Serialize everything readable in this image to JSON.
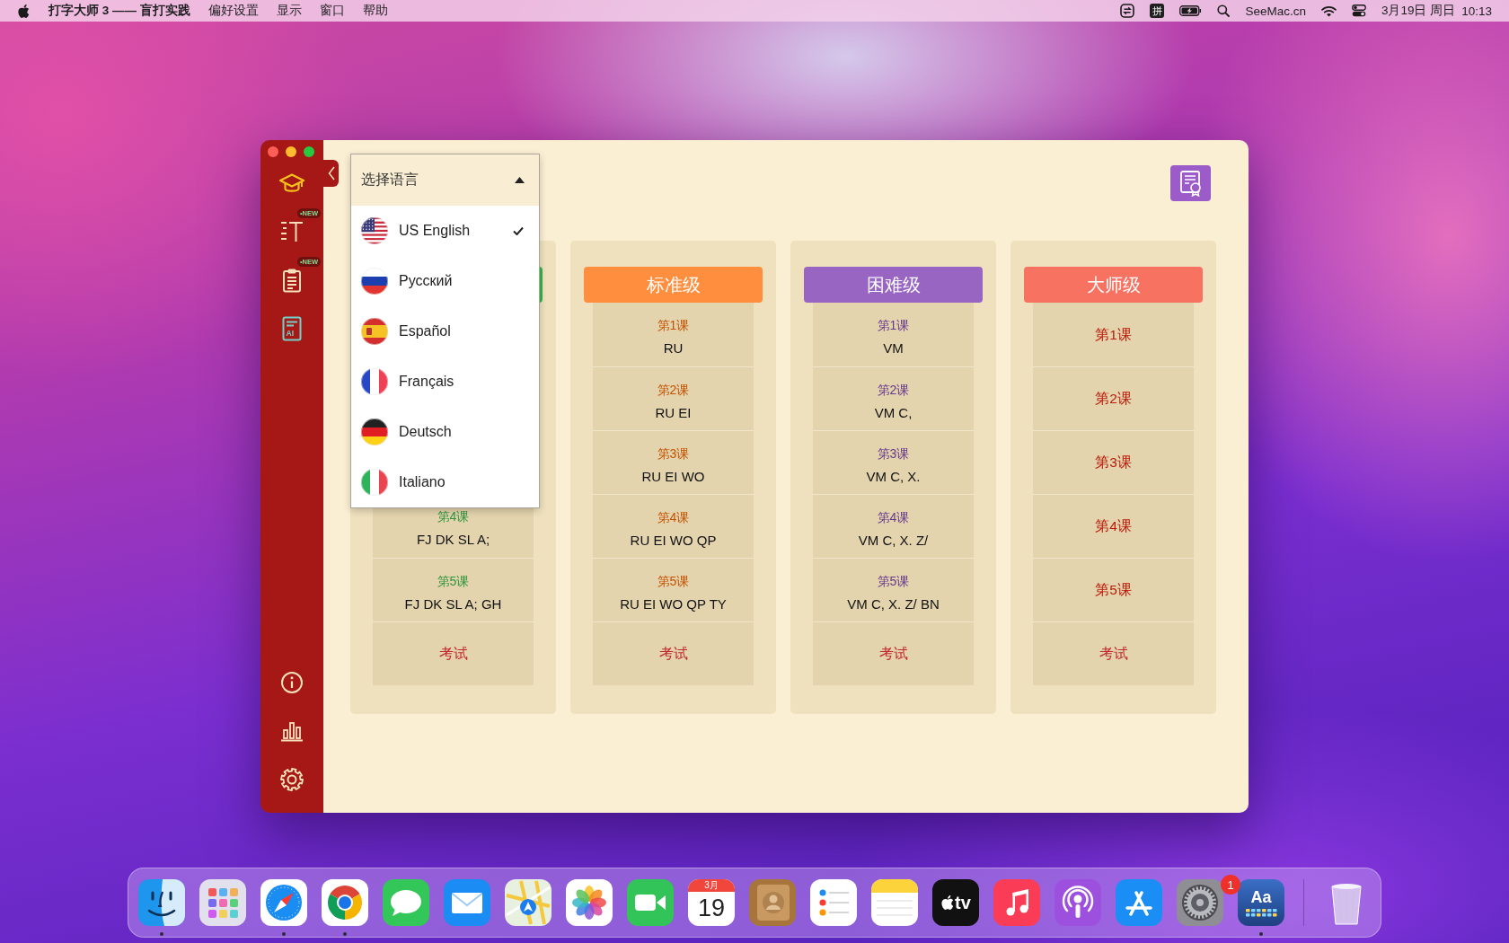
{
  "menu_bar": {
    "app_name": "打字大师 3 —— 盲打实践",
    "menus": [
      "偏好设置",
      "显示",
      "窗口",
      "帮助"
    ],
    "input_method": "拼",
    "site": "SeeMac.cn",
    "date": "3月19日 周日",
    "time": "10:13"
  },
  "sidebar": {
    "items": [
      {
        "selected": true
      },
      {
        "selected": false,
        "badge": "•NEW"
      },
      {
        "selected": false,
        "badge": "•NEW"
      },
      {
        "selected": false,
        "icon_text": "AI"
      }
    ]
  },
  "language_menu": {
    "title": "选择语言",
    "expanded": true,
    "options": [
      {
        "label": "US English",
        "selected": true
      },
      {
        "label": "Русский",
        "selected": false
      },
      {
        "label": "Español",
        "selected": false
      },
      {
        "label": "Français",
        "selected": false
      },
      {
        "label": "Deutsch",
        "selected": false
      },
      {
        "label": "Italiano",
        "selected": false
      }
    ]
  },
  "levels": [
    {
      "color": "#36b54a",
      "lessons": [
        {
          "kind": "lesson",
          "label": "第4课",
          "keys": "FJ DK SL A;"
        },
        {
          "kind": "lesson",
          "label": "第5课",
          "keys": "FJ DK SL A; GH"
        },
        {
          "kind": "exam",
          "label": "考试"
        }
      ]
    },
    {
      "title": "标准级",
      "color": "#ff8e3e",
      "lessons": [
        {
          "kind": "lesson",
          "label": "第1课",
          "keys": "RU"
        },
        {
          "kind": "lesson",
          "label": "第2课",
          "keys": "RU EI"
        },
        {
          "kind": "lesson",
          "label": "第3课",
          "keys": "RU EI WO"
        },
        {
          "kind": "lesson",
          "label": "第4课",
          "keys": "RU EI WO QP"
        },
        {
          "kind": "lesson",
          "label": "第5课",
          "keys": "RU EI WO QP TY"
        },
        {
          "kind": "exam",
          "label": "考试"
        }
      ]
    },
    {
      "title": "困难级",
      "color": "#9866c2",
      "lessons": [
        {
          "kind": "lesson",
          "label": "第1课",
          "keys": "VM"
        },
        {
          "kind": "lesson",
          "label": "第2课",
          "keys": "VM C,"
        },
        {
          "kind": "lesson",
          "label": "第3课",
          "keys": "VM C, X."
        },
        {
          "kind": "lesson",
          "label": "第4课",
          "keys": "VM C, X. Z/"
        },
        {
          "kind": "lesson",
          "label": "第5课",
          "keys": "VM C, X. Z/ BN"
        },
        {
          "kind": "exam",
          "label": "考试"
        }
      ]
    },
    {
      "title": "大师级",
      "color": "#f87262",
      "lessons": [
        {
          "kind": "lesson",
          "label": "第1课"
        },
        {
          "kind": "lesson",
          "label": "第2课"
        },
        {
          "kind": "lesson",
          "label": "第3课"
        },
        {
          "kind": "lesson",
          "label": "第4课"
        },
        {
          "kind": "lesson",
          "label": "第5课"
        },
        {
          "kind": "exam",
          "label": "考试"
        }
      ]
    }
  ],
  "dock": {
    "items": [
      {
        "running": true
      },
      {
        "running": false
      },
      {
        "running": true
      },
      {
        "running": true
      },
      {
        "running": false
      },
      {
        "running": false
      },
      {
        "running": false
      },
      {
        "running": false
      },
      {
        "running": false
      },
      {
        "running": false,
        "month": "3月",
        "day": "19"
      },
      {
        "running": false
      },
      {
        "running": false
      },
      {
        "running": false
      },
      {
        "running": false,
        "label": "tv"
      },
      {
        "running": false
      },
      {
        "running": false
      },
      {
        "running": false
      },
      {
        "running": false,
        "badge": "1"
      },
      {
        "running": true,
        "label": "Aa"
      },
      {
        "running": false
      }
    ]
  }
}
